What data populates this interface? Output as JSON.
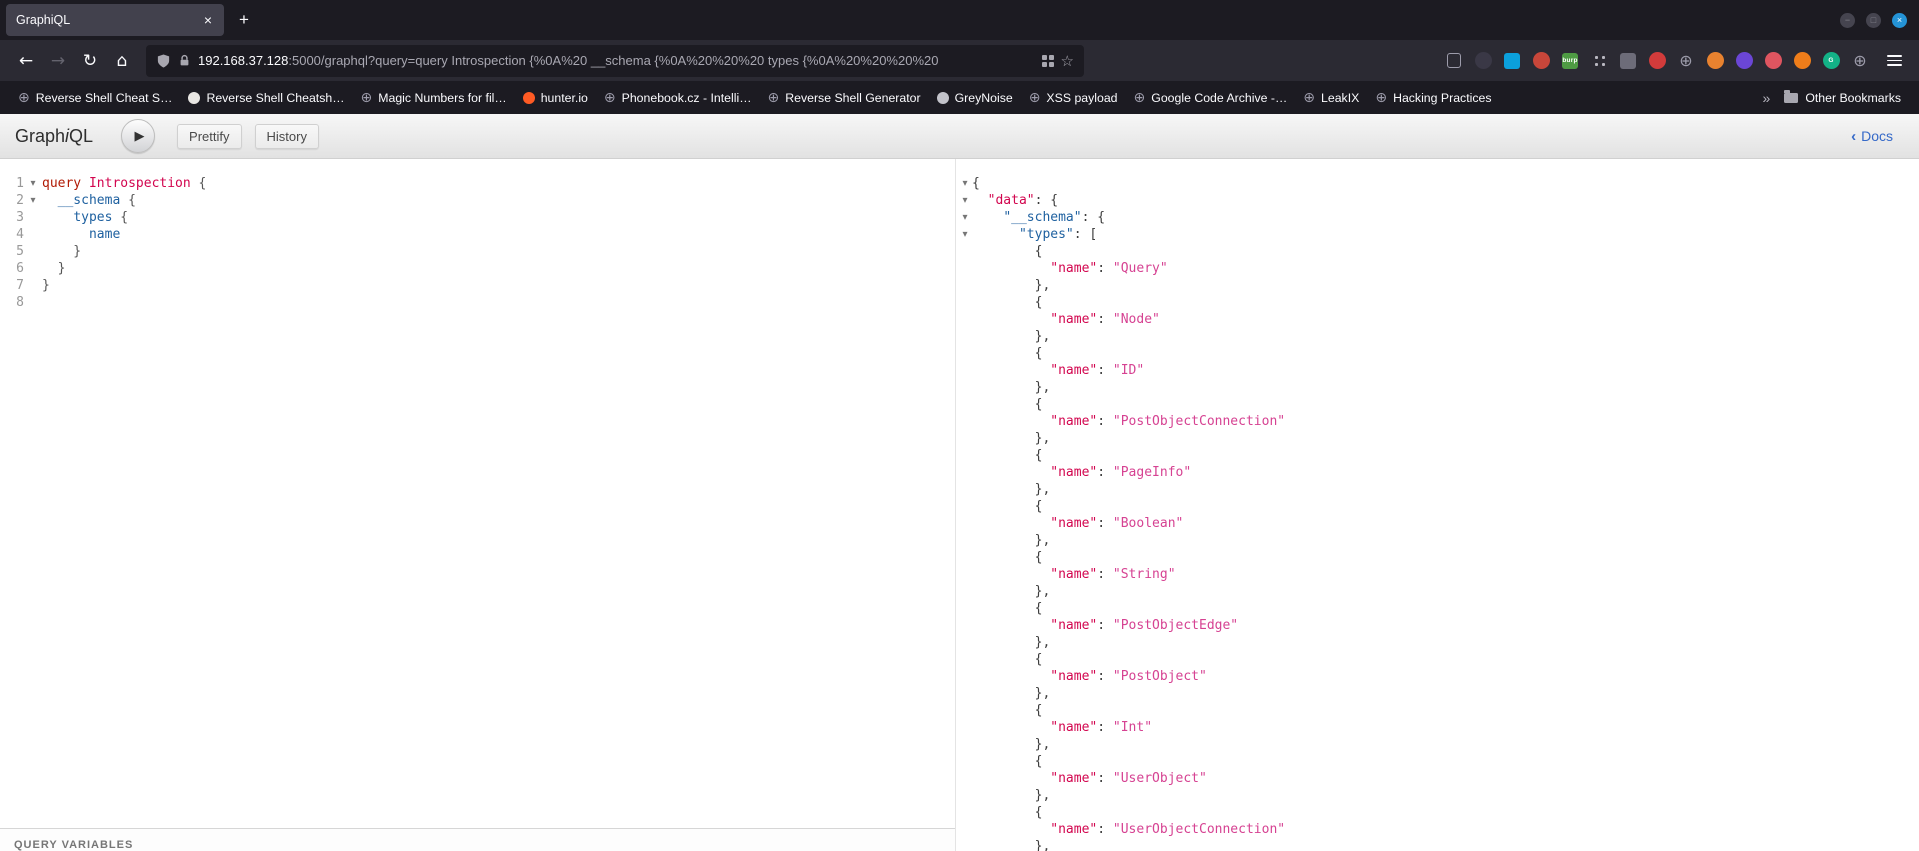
{
  "browser": {
    "tab_title": "GraphiQL",
    "tab_close": "×",
    "new_tab": "+",
    "window_controls": {
      "close_glyph": "×"
    },
    "nav": {
      "back": "←",
      "forward": "→",
      "reload": "↻",
      "home": "⌂",
      "url_host": "192.168.37.128",
      "url_rest": ":5000/graphql?query=query Introspection {%0A%20 __schema {%0A%20%20%20 types {%0A%20%20%20%20",
      "star": "☆"
    },
    "extensions": [
      {
        "name": "save-page-icon",
        "shape": "outline"
      },
      {
        "name": "dark-circle-extension-icon",
        "shape": "circle",
        "color": "#3a3846"
      },
      {
        "name": "blue-square-extension-icon",
        "shape": "square",
        "color": "#0ba0dc"
      },
      {
        "name": "red-circle-extension-icon",
        "shape": "circle",
        "color": "#c8463a"
      },
      {
        "name": "burp-extension-icon",
        "shape": "square",
        "color": "#4e9b43",
        "label": "burp"
      },
      {
        "name": "apps-grid-icon",
        "shape": "dots"
      },
      {
        "name": "gray-extension-icon",
        "shape": "square",
        "color": "#6d6c79"
      },
      {
        "name": "ublock-extension-icon",
        "shape": "circle",
        "color": "#d23b3b"
      },
      {
        "name": "globe-extension-icon",
        "shape": "glyph",
        "glyph": "⊕"
      },
      {
        "name": "orange-extension-icon",
        "shape": "circle",
        "color": "#e8822f"
      },
      {
        "name": "purple-extension-icon",
        "shape": "circle",
        "color": "#6b46d6"
      },
      {
        "name": "pink-dot-extension-icon",
        "shape": "circle",
        "color": "#df5560"
      },
      {
        "name": "foxyproxy-extension-icon",
        "shape": "circle",
        "color": "#ef7d1a"
      },
      {
        "name": "green-g-extension-icon",
        "shape": "circle",
        "color": "#13b287",
        "label": "G"
      },
      {
        "name": "globe2-extension-icon",
        "shape": "glyph",
        "glyph": "⊕"
      }
    ],
    "bookmarks": [
      {
        "label": "Reverse Shell Cheat S…",
        "icon": "globe"
      },
      {
        "label": "Reverse Shell Cheatsh…",
        "icon": "github"
      },
      {
        "label": "Magic Numbers for fil…",
        "icon": "globe"
      },
      {
        "label": "hunter.io",
        "icon": "hunter"
      },
      {
        "label": "Phonebook.cz - Intelli…",
        "icon": "globe"
      },
      {
        "label": "Reverse Shell Generator",
        "icon": "globe"
      },
      {
        "label": "GreyNoise",
        "icon": "greynoise"
      },
      {
        "label": "XSS payload",
        "icon": "globe"
      },
      {
        "label": "Google Code Archive -…",
        "icon": "globe"
      },
      {
        "label": "LeakIX",
        "icon": "globe"
      },
      {
        "label": "Hacking Practices",
        "icon": "globe"
      }
    ],
    "overflow_chevron": "»",
    "other_bookmarks": "Other Bookmarks"
  },
  "graphiql": {
    "logo_graph": "Graph",
    "logo_i": "i",
    "logo_ql": "QL",
    "execute_icon": "▶",
    "prettify": "Prettify",
    "history": "History",
    "docs_chevron": "‹",
    "docs": "Docs",
    "variables_label": "QUERY VARIABLES",
    "query": {
      "lines": [
        {
          "n": "1",
          "fold": true,
          "tokens": [
            [
              "query",
              "kw"
            ],
            [
              " ",
              "pl"
            ],
            [
              "Introspection",
              "def"
            ],
            [
              " {",
              "pun"
            ]
          ]
        },
        {
          "n": "2",
          "fold": true,
          "tokens": [
            [
              "  ",
              "pl"
            ],
            [
              "__schema",
              "prop"
            ],
            [
              " {",
              "pun"
            ]
          ]
        },
        {
          "n": "3",
          "fold": false,
          "tokens": [
            [
              "    ",
              "pl"
            ],
            [
              "types",
              "prop"
            ],
            [
              " {",
              "pun"
            ]
          ]
        },
        {
          "n": "4",
          "fold": false,
          "tokens": [
            [
              "      ",
              "pl"
            ],
            [
              "name",
              "prop"
            ]
          ]
        },
        {
          "n": "5",
          "fold": false,
          "tokens": [
            [
              "    }",
              "pun"
            ]
          ]
        },
        {
          "n": "6",
          "fold": false,
          "tokens": [
            [
              "  }",
              "pun"
            ]
          ]
        },
        {
          "n": "7",
          "fold": false,
          "tokens": [
            [
              "}",
              "pun"
            ]
          ]
        },
        {
          "n": "8",
          "fold": false,
          "tokens": []
        }
      ]
    },
    "response": {
      "open_keys": [
        {
          "key": "data",
          "color": "red",
          "open": "{"
        },
        {
          "key": "__schema",
          "color": "blue",
          "open": "{"
        },
        {
          "key": "types",
          "color": "blue",
          "open": "["
        }
      ],
      "item_key": {
        "key": "name",
        "color": "red"
      },
      "types": [
        "Query",
        "Node",
        "ID",
        "PostObjectConnection",
        "PageInfo",
        "Boolean",
        "String",
        "PostObjectEdge",
        "PostObject",
        "Int",
        "UserObject",
        "UserObjectConnection"
      ]
    }
  },
  "colors": {
    "chrome_dark": "#1c1b22",
    "chrome_mid": "#2b2a33",
    "keyword_red": "#B11A04",
    "operation_crimson": "#D2054E",
    "field_blue": "#1F61A0",
    "string_pink": "#D64292",
    "docs_link_blue": "#3569c8",
    "topbar_gradient_top": "#f7f7f7",
    "topbar_gradient_bottom": "#e2e2e2"
  }
}
